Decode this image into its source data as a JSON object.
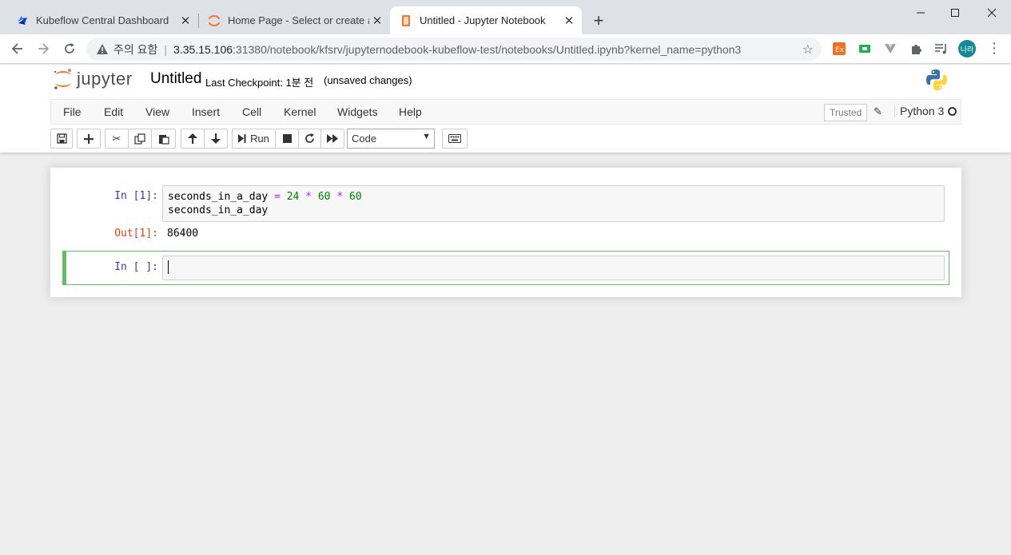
{
  "browser": {
    "tabs": [
      {
        "title": "Kubeflow Central Dashboard",
        "active": false
      },
      {
        "title": "Home Page - Select or create a",
        "active": false
      },
      {
        "title": "Untitled - Jupyter Notebook",
        "active": true
      }
    ],
    "close_glyph": "✕",
    "new_tab_glyph": "+",
    "window_controls": {
      "minimize": "—",
      "maximize": "☐",
      "close": "✕"
    },
    "address": {
      "security_label": "주의 요함",
      "separator": "|",
      "host": "3.35.15.106",
      "path": ":31380/notebook/kfsrv/jupyternodebook-kubeflow-test/notebooks/Untitled.ipynb?kernel_name=python3"
    },
    "profile_initials": "나라",
    "accent_color": "#128a96"
  },
  "jupyter": {
    "logo_text": "jupyter",
    "notebook_name": "Untitled",
    "checkpoint": "Last Checkpoint: 1분 전",
    "autosave": "(unsaved changes)",
    "menu": [
      "File",
      "Edit",
      "View",
      "Insert",
      "Cell",
      "Kernel",
      "Widgets",
      "Help"
    ],
    "trusted": "Trusted",
    "kernel": "Python 3",
    "toolbar": {
      "run_label": "Run",
      "cell_type": "Code"
    }
  },
  "cells": [
    {
      "prompt": "In [1]:",
      "code_lines": [
        {
          "tokens": [
            {
              "t": "seconds_in_a_day ",
              "c": ""
            },
            {
              "t": "=",
              "c": "cm-eq"
            },
            {
              "t": " ",
              "c": ""
            },
            {
              "t": "24",
              "c": "cm-num"
            },
            {
              "t": " ",
              "c": ""
            },
            {
              "t": "*",
              "c": "cm-op"
            },
            {
              "t": " ",
              "c": ""
            },
            {
              "t": "60",
              "c": "cm-num"
            },
            {
              "t": " ",
              "c": ""
            },
            {
              "t": "*",
              "c": "cm-op"
            },
            {
              "t": " ",
              "c": ""
            },
            {
              "t": "60",
              "c": "cm-num"
            }
          ]
        },
        {
          "tokens": [
            {
              "t": "seconds_in_a_day",
              "c": ""
            }
          ]
        }
      ],
      "out_prompt": "Out[1]:",
      "output": "86400"
    },
    {
      "prompt": "In [ ]:",
      "code_lines": []
    }
  ]
}
